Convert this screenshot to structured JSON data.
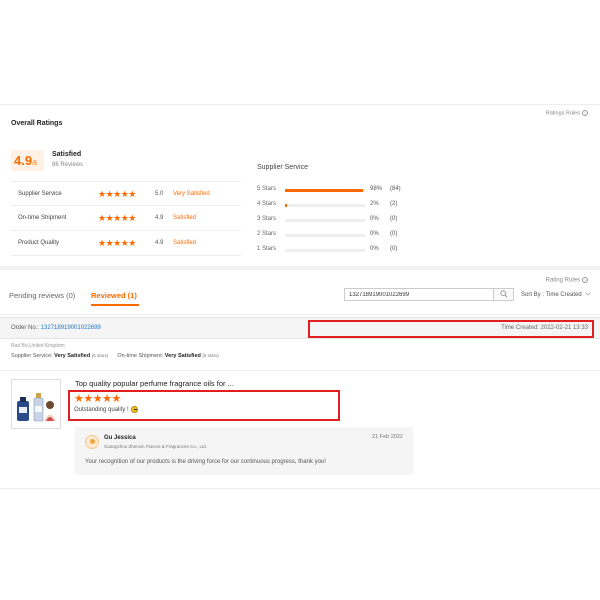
{
  "overall": {
    "title": "Overall Ratings",
    "rules_link": "Ratings Rules",
    "score": "4.9",
    "score_out_of": "/5",
    "satisfaction": "Satisfied",
    "reviews_count": "86 Reviews",
    "ratings": [
      {
        "label": "Supplier Service",
        "stars": "★★★★★",
        "score": "5.0",
        "word": "Very Satisfied"
      },
      {
        "label": "On-time Shipment",
        "stars": "★★★★★",
        "score": "4.9",
        "word": "Satisfied"
      },
      {
        "label": "Product Quality",
        "stars": "★★★★★",
        "score": "4.9",
        "word": "Satisfied"
      }
    ]
  },
  "supplier_service": {
    "title": "Supplier Service",
    "distribution": [
      {
        "label": "5 Stars",
        "pct": "98%",
        "count": "(84)",
        "fraction": 0.98
      },
      {
        "label": "4 Stars",
        "pct": "2%",
        "count": "(2)",
        "fraction": 0.02
      },
      {
        "label": "3 Stars",
        "pct": "0%",
        "count": "(0)",
        "fraction": 0
      },
      {
        "label": "2 Stars",
        "pct": "0%",
        "count": "(0)",
        "fraction": 0
      },
      {
        "label": "1 Stars",
        "pct": "0%",
        "count": "(0)",
        "fraction": 0
      }
    ]
  },
  "tabs": {
    "rating_rules": "Rating Rules",
    "pending": "Pending reviews (0)",
    "reviewed": "Reviewed (1)",
    "search_value": "132718919001022699",
    "sort_by": "Sort By : Time Created"
  },
  "order": {
    "label": "Order No.: ",
    "number": "132718919001022699",
    "time_created": "Time Created: 2022-02-21 13:33",
    "buyer_location": "Rad Bo,United Kingdom",
    "supplier_service_label": "Supplier Service: ",
    "supplier_service_value": "Very Satisfied",
    "supplier_service_stars": "(5 stars)",
    "shipment_label": "On-time Shipment: ",
    "shipment_value": "Very Satisfied",
    "shipment_stars": "(5 stars)"
  },
  "review": {
    "product_title": "Top quality popular perfume fragrance oils for ...",
    "stars": "★★★★★",
    "text": "Outstanding quality !"
  },
  "reply": {
    "name": "Gu Jessica",
    "company": "Guangzhou Zhenxin Flavors & Fragrances Co., Ltd.",
    "date": "21 Feb 2022",
    "text": "Your recognition of our products is the driving force for our continuous progress, thank you!"
  },
  "colors": {
    "accent": "#ff6a00",
    "link": "#1a73c8",
    "highlight": "#e02020"
  },
  "icons": [
    "info-icon",
    "search-icon",
    "chevron-down-icon",
    "smile-emoji-icon",
    "supplier-avatar"
  ]
}
